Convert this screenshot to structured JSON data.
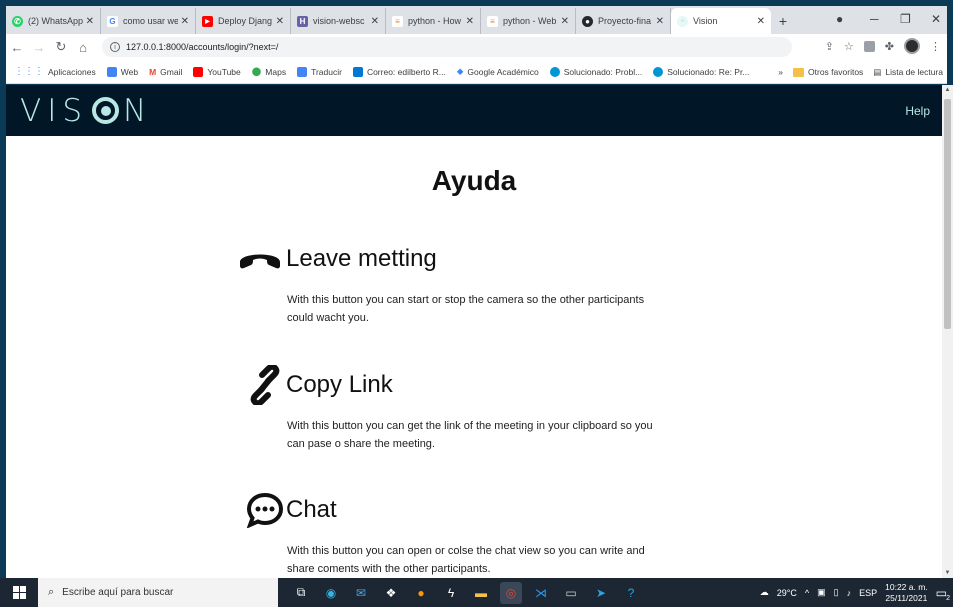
{
  "browser": {
    "tabs": [
      {
        "label": "(2) WhatsApp",
        "icon": "whatsapp-icon",
        "color": "#25d366",
        "glyph": "✆"
      },
      {
        "label": "como usar we",
        "icon": "google-icon",
        "color": "#4285f4",
        "glyph": "G"
      },
      {
        "label": "Deploy Djang",
        "icon": "youtube-icon",
        "color": "#ff0000",
        "glyph": "▶"
      },
      {
        "label": "vision-websc",
        "icon": "heroku-icon",
        "color": "#6762a6",
        "glyph": "H"
      },
      {
        "label": "python - How",
        "icon": "stackoverflow-icon",
        "color": "#f48024",
        "glyph": "≡"
      },
      {
        "label": "python - Web",
        "icon": "stackoverflow-icon",
        "color": "#f48024",
        "glyph": "≡"
      },
      {
        "label": "Proyecto-fina",
        "icon": "github-icon",
        "color": "#24292e",
        "glyph": "●"
      },
      {
        "label": "Vision",
        "icon": "vision-tab-icon",
        "color": "#b8e8e4",
        "glyph": "●"
      }
    ],
    "url": "127.0.0.1:8000/accounts/login/?next=/",
    "bookmarks": [
      {
        "label": "Aplicaciones",
        "color": "#ea4335"
      },
      {
        "label": "Web",
        "color": "#4285f4"
      },
      {
        "label": "Gmail",
        "color": "#ea4335"
      },
      {
        "label": "YouTube",
        "color": "#ff0000"
      },
      {
        "label": "Maps",
        "color": "#34a853"
      },
      {
        "label": "Traducir",
        "color": "#4285f4"
      },
      {
        "label": "Correo: edilberto R...",
        "color": "#0078d4"
      },
      {
        "label": "Google Académico",
        "color": "#4285f4"
      },
      {
        "label": "Solucionado: Probl...",
        "color": "#0096d6"
      },
      {
        "label": "Solucionado: Re: Pr...",
        "color": "#0096d6"
      }
    ],
    "bookmarks_overflow": "»",
    "other_bookmarks": "Otros favoritos",
    "reading_list": "Lista de lectura"
  },
  "app": {
    "logo_left": "VIS",
    "logo_right": "N",
    "nav_help": "Help",
    "page_title": "Ayuda",
    "sections": [
      {
        "title": "Leave metting",
        "icon": "phone-hangup-icon",
        "body": "With this button you can start or stop the camera so the other participants could wacht you."
      },
      {
        "title": "Copy Link",
        "icon": "link-icon",
        "body": "With this button you can get the link of the meeting in your clipboard so you can pase o share the meeting."
      },
      {
        "title": "Chat",
        "icon": "chat-icon",
        "body": "With this button you can open or colse the chat view so you can write and share coments with the other participants."
      }
    ]
  },
  "taskbar": {
    "search_placeholder": "Escribe aquí para buscar",
    "temperature": "29°C",
    "language": "ESP",
    "time": "10:22 a. m.",
    "date": "25/11/2021",
    "notifications": "2"
  }
}
